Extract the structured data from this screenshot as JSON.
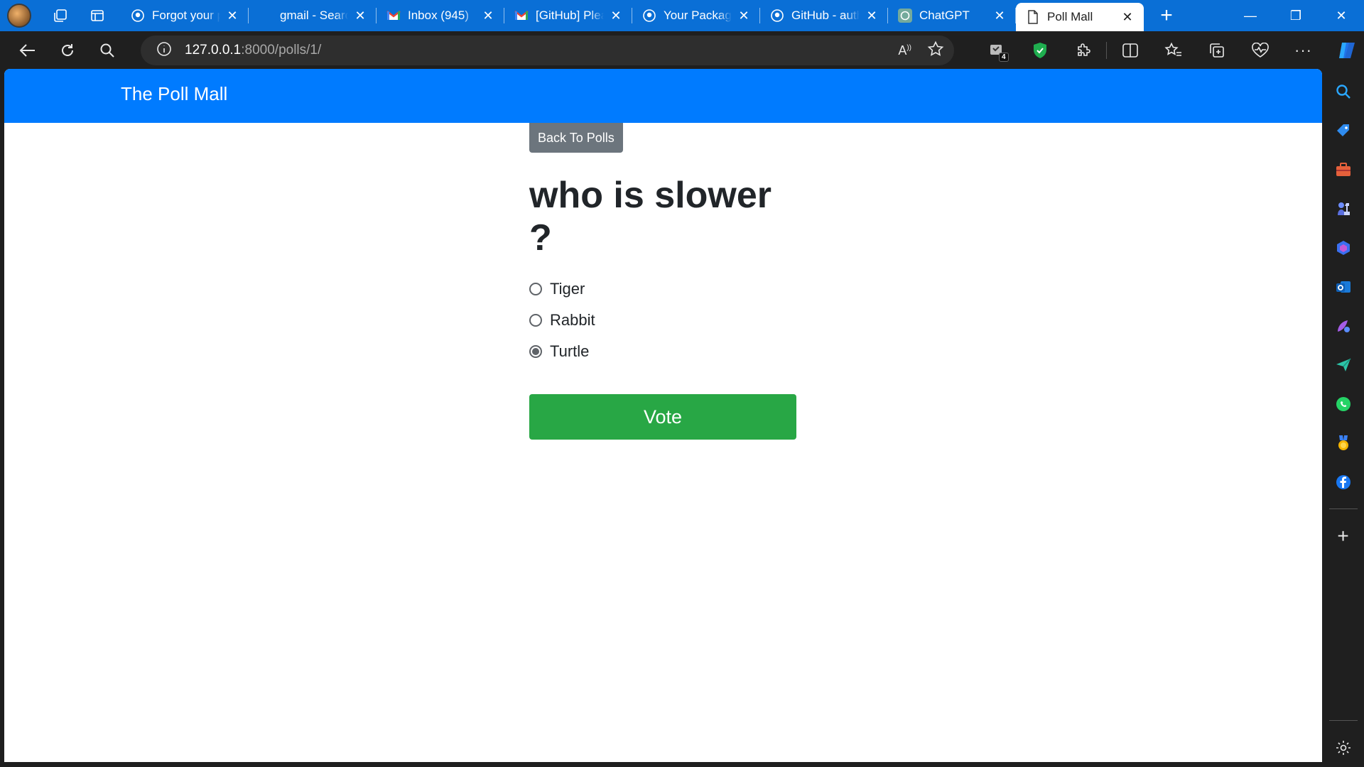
{
  "tabs": [
    {
      "title": "Forgot your password?",
      "favicon": "github-icon",
      "active": false
    },
    {
      "title": "gmail - Search",
      "favicon": "none",
      "active": false
    },
    {
      "title": "Inbox (945)",
      "favicon": "gmail-icon",
      "active": false
    },
    {
      "title": "[GitHub] Please verify",
      "favicon": "gmail-icon",
      "active": false
    },
    {
      "title": "Your Packages",
      "favicon": "github-icon",
      "active": false
    },
    {
      "title": "GitHub - auth",
      "favicon": "github-icon",
      "active": false
    },
    {
      "title": "ChatGPT",
      "favicon": "chatgpt-icon",
      "active": false
    },
    {
      "title": "Poll Mall",
      "favicon": "page-icon",
      "active": true
    }
  ],
  "address_bar": {
    "host": "127.0.0.1",
    "path": ":8000/polls/1/"
  },
  "extensions_badge": "4",
  "page": {
    "brand": "The Poll Mall",
    "back_button": "Back To Polls",
    "question": "who is slower ?",
    "choices": [
      {
        "label": "Tiger",
        "checked": false
      },
      {
        "label": "Rabbit",
        "checked": false
      },
      {
        "label": "Turtle",
        "checked": true
      }
    ],
    "vote_button": "Vote"
  },
  "colors": {
    "tabstrip": "#0a6fd6",
    "navbar": "#007bff",
    "back_button": "#6c757d",
    "vote_button": "#28a745"
  }
}
